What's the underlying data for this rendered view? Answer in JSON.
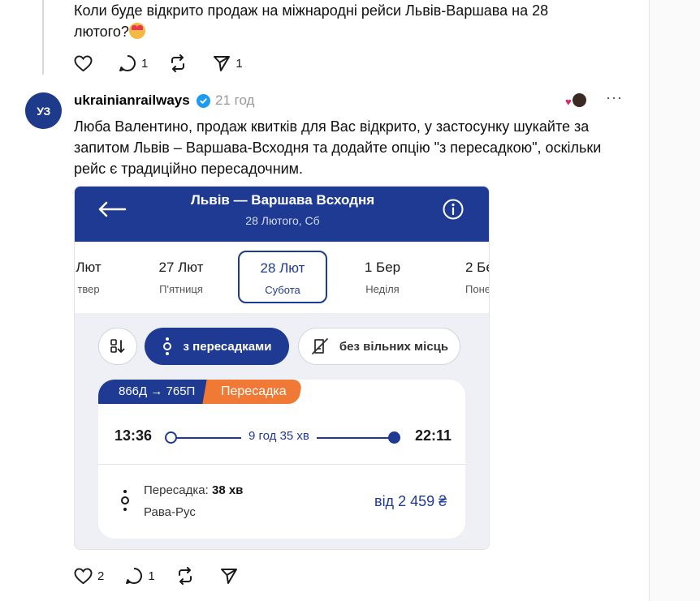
{
  "previous_post": {
    "text": "Коли буде відкрито продаж на міжнародні рейси Львів-Варшава на 28 лютого?",
    "emoji": "smiling-face-with-hearts",
    "actions": {
      "like_count": "",
      "reply_count": "1",
      "repost_count": "",
      "share_count": "1"
    }
  },
  "reply": {
    "avatar_text": "УЗ",
    "username": "ukrainianrailways",
    "time_ago": "21 год",
    "more": "···",
    "text": "Люба Валентино, продаж квитків для Вас відкрито, у застосунку шукайте за запитом Львів – Варшава-Всходня та додайте опцію \"з пересадкою\", оскільки рейс є традиційно пересадочним.",
    "actions": {
      "like_count": "2",
      "reply_count": "1",
      "repost_count": "",
      "share_count": ""
    }
  },
  "app": {
    "route_title": "Львів — Варшава Всходня",
    "route_date": "28 Лютого, Сб",
    "dates": [
      {
        "day": "Лют",
        "weekday": "твер"
      },
      {
        "day": "27 Лют",
        "weekday": "П'ятниця"
      },
      {
        "day": "28 Лют",
        "weekday": "Субота",
        "selected": true
      },
      {
        "day": "1 Бер",
        "weekday": "Неділя"
      },
      {
        "day": "2 Бе",
        "weekday": "Понед"
      }
    ],
    "filters": {
      "transfer_label": "з пересадками",
      "seats_label": "без вільних місць"
    },
    "train": {
      "number": "866Д → 765П",
      "tag": "Пересадка",
      "departure": "13:36",
      "arrival": "22:11",
      "duration": "9 год 35 хв",
      "change_label": "Пересадка: ",
      "change_time": "38 хв",
      "change_station": "Рава-Рус",
      "price": "від 2 459 ₴"
    }
  },
  "colors": {
    "brand_blue": "#1f3a93",
    "accent_orange": "#f07a35",
    "verified_blue": "#1d9bf0"
  }
}
